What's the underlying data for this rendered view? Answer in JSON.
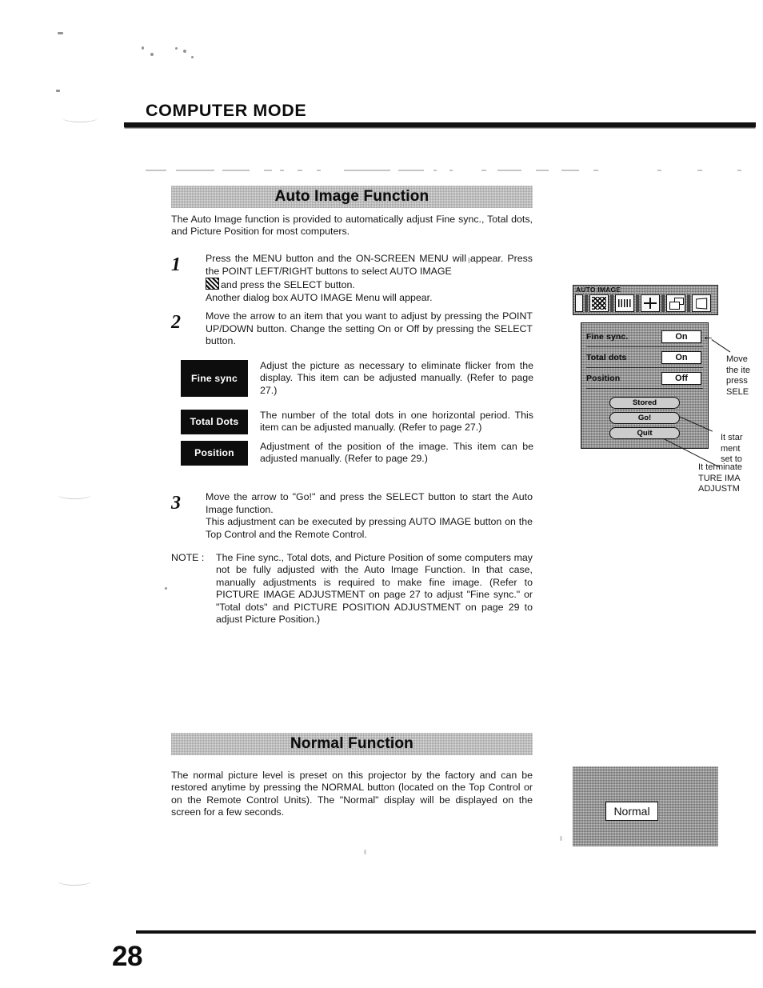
{
  "page": {
    "chapter_title": "COMPUTER MODE",
    "page_number": "28"
  },
  "auto_image_section": {
    "heading": "Auto Image Function",
    "intro": "The Auto Image function is provided to automatically adjust Fine sync., Total dots, and Picture Position for most computers.",
    "steps": [
      {
        "number": "1",
        "line1": "Press the MENU button and the ON-SCREEN MENU will appear. Press the POINT LEFT/RIGHT buttons to select AUTO IMAGE",
        "icon": "auto-image-checker-icon",
        "line2": "and press the SELECT button.",
        "line3": "Another dialog box AUTO IMAGE Menu will appear."
      },
      {
        "number": "2",
        "line1": "Move the arrow to an item that you want to adjust by pressing the POINT UP/DOWN button.  Change the setting On or Off by pressing the SELECT button."
      },
      {
        "number": "3",
        "line1": "Move the arrow to \"Go!\" and press the SELECT button to start the Auto Image function.",
        "line2": "This adjustment can be executed by pressing AUTO IMAGE button on the Top Control and the Remote Control."
      }
    ],
    "definitions": [
      {
        "label": "Fine sync",
        "text": "Adjust the picture as necessary to eliminate flicker from the display.  This item can be adjusted manually.  (Refer to page 27.)"
      },
      {
        "label": "Total Dots",
        "text": "The number of the total dots in one horizontal period. This item can be adjusted manually.  (Refer to page 27.)"
      },
      {
        "label": "Position",
        "text": "Adjustment of the position of the image.  This item can be adjusted manually.  (Refer to page 29.)"
      }
    ],
    "note": {
      "label": "NOTE :",
      "text": "The Fine sync., Total dots, and Picture Position of some computers may not be fully adjusted with the Auto Image Function.  In that case, manually adjustments is required to make fine image.  (Refer to PICTURE IMAGE ADJUSTMENT on page 27 to adjust \"Fine sync.\" or \"Total dots\" and PICTURE POSITION ADJUSTMENT on page 29 to adjust Picture Position.)"
    }
  },
  "osd_figure": {
    "menubar_title": "AUTO IMAGE",
    "menu_icons": [
      "partial-left-icon",
      "fine-sync-wave-icon",
      "total-dots-icon",
      "position-arrows-icon",
      "screen-overlap-icon",
      "keystone-trapezoid-icon"
    ],
    "dialog": {
      "settings": [
        {
          "label": "Fine sync.",
          "value": "On"
        },
        {
          "label": "Total dots",
          "value": "On"
        },
        {
          "label": "Position",
          "value": "Off"
        }
      ],
      "buttons": [
        "Stored",
        "Go!",
        "Quit"
      ],
      "cursor_arrow": "←"
    },
    "callouts": [
      {
        "name": "move-arrow-callout",
        "lines": "Move\nthe ite\npress\nSELE"
      },
      {
        "name": "go-start-callout",
        "lines": "It star\nment \nset to"
      },
      {
        "name": "quit-terminate-callout",
        "lines": "It terminate\nTURE IMA\nADJUSTM"
      }
    ]
  },
  "normal_section": {
    "heading": "Normal Function",
    "text": "The normal picture level is preset on this projector by the factory and can be restored anytime by pressing the NORMAL button (located on the Top Control or on the Remote Control Units).  The \"Normal\" display will be displayed on the screen for a few seconds.",
    "display_label": "Normal"
  }
}
